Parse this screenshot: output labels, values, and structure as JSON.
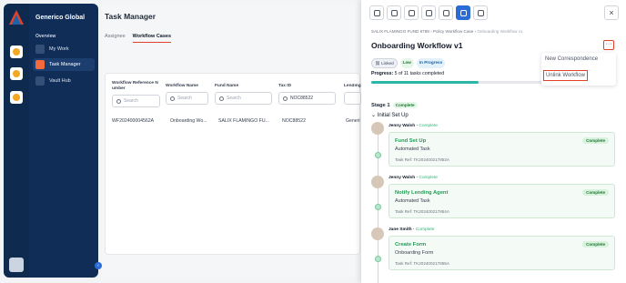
{
  "sidebar": {
    "org_name": "Generico Global",
    "section": "Overview",
    "items": [
      {
        "label": "My Work",
        "icon": "briefcase-icon",
        "active": false
      },
      {
        "label": "Task Manager",
        "icon": "bell-icon",
        "active": true
      },
      {
        "label": "Vault Hub",
        "icon": "vault-icon",
        "active": false
      }
    ]
  },
  "main": {
    "title": "Task Manager",
    "tabs": [
      {
        "label": "Assignee",
        "active": false
      },
      {
        "label": "Workflow Cases",
        "active": true
      }
    ],
    "columns": [
      {
        "header": "Workflow Reference N umber",
        "placeholder": "Search",
        "value": ""
      },
      {
        "header": "Workflow Name",
        "placeholder": "Search",
        "value": ""
      },
      {
        "header": "Fund Name",
        "placeholder": "Search",
        "value": ""
      },
      {
        "header": "Tax ID",
        "placeholder": "",
        "value": "NOC88522"
      },
      {
        "header": "Lending A",
        "placeholder": "",
        "value": ""
      }
    ],
    "rows": [
      {
        "ref": "WF202400004562A",
        "name": "Onboarding Wo...",
        "fund": "SALIX FLAMINGO FU...",
        "tax": "NOC88522",
        "lending": "Generi"
      }
    ]
  },
  "panel": {
    "toolbar": [
      "user-icon",
      "cloud-icon",
      "folder-icon",
      "clipboard-icon",
      "link-icon",
      "workflow-icon",
      "mail-icon"
    ],
    "close": "×",
    "breadcrumb": {
      "a": "SALIX FLAMINGO FUND 6789",
      "b": "Policy Workflow Case",
      "c": "Onboarding Workflow v1"
    },
    "title": "Onboarding Workflow v1",
    "more": "···",
    "badges": {
      "linked": "Linked",
      "priority": "Low",
      "status": "In Progress"
    },
    "progress": {
      "label": "Progress:",
      "text": "5 of 11 tasks completed",
      "fraction": 0.45
    },
    "menu": {
      "item1": "New Correspondence",
      "item2": "Unlink Workflow"
    },
    "stage": {
      "label": "Stage 1",
      "status": "Complete",
      "sub": "Initial Set Up"
    },
    "tasks": [
      {
        "person": "Jenny Walsh",
        "status": "Complete",
        "title": "Fund Set Up",
        "type": "Automated Task",
        "ref": "Task Ref: TK202400217853A",
        "badge": "Complete"
      },
      {
        "person": "Jenny Walsh",
        "status": "Complete",
        "title": "Notify Lending Agent",
        "type": "Automated Task",
        "ref": "Task Ref: TK202400217854A",
        "badge": "Complete"
      },
      {
        "person": "Jane Smith",
        "status": "Complete",
        "title": "Create Form",
        "type": "Onboarding Form",
        "ref": "Task Ref: TK202400217855A",
        "badge": "Complete"
      }
    ]
  }
}
